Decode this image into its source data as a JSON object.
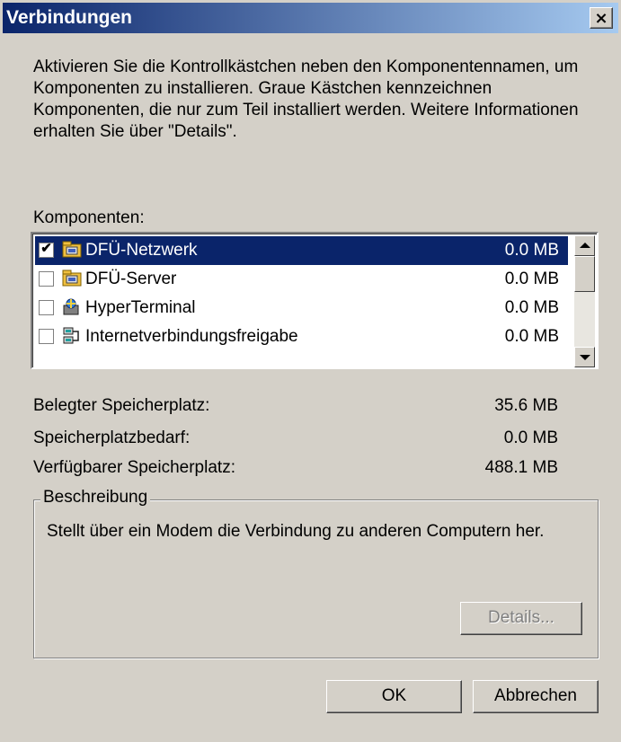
{
  "window": {
    "title": "Verbindungen",
    "close_glyph": "×"
  },
  "intro_text": "Aktivieren Sie die Kontrollkästchen neben den Komponentennamen, um Komponenten zu installieren. Graue Kästchen kennzeichnen Komponenten, die nur zum Teil installiert werden. Weitere Informationen erhalten Sie über \"Details\".",
  "components": {
    "label": "Komponenten:",
    "items": [
      {
        "name": "DFÜ-Netzwerk",
        "size": "0.0 MB",
        "checked": true,
        "selected": true,
        "icon": "dialup-network-icon"
      },
      {
        "name": "DFÜ-Server",
        "size": "0.0 MB",
        "checked": false,
        "selected": false,
        "icon": "dialup-server-icon"
      },
      {
        "name": "HyperTerminal",
        "size": "0.0 MB",
        "checked": false,
        "selected": false,
        "icon": "hyperterminal-icon"
      },
      {
        "name": "Internetverbindungsfreigabe",
        "size": "0.0 MB",
        "checked": false,
        "selected": false,
        "icon": "internet-sharing-icon"
      }
    ]
  },
  "disk": {
    "used_label": "Belegter Speicherplatz:",
    "used_value": "35.6 MB",
    "required_label": "Speicherplatzbedarf:",
    "required_value": "0.0 MB",
    "free_label": "Verfügbarer Speicherplatz:",
    "free_value": "488.1 MB"
  },
  "description": {
    "legend": "Beschreibung",
    "text": "Stellt über ein Modem die Verbindung zu anderen Computern her.",
    "details_button": "Details..."
  },
  "buttons": {
    "ok": "OK",
    "cancel": "Abbrechen"
  },
  "colors": {
    "selection": "#0a246a",
    "dialog_bg": "#d4d0c8"
  }
}
